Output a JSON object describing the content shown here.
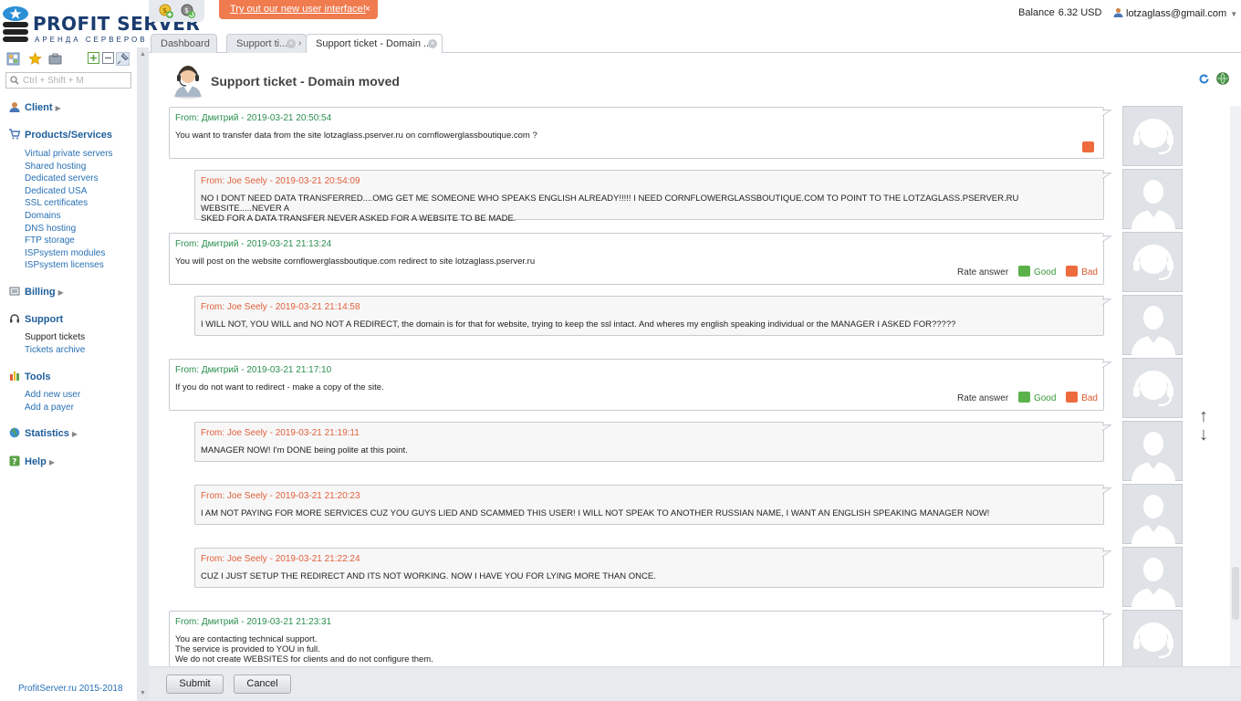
{
  "brand": {
    "name_part1": "PROFIT",
    "name_part2": "SERVER",
    "tagline": "АРЕНДА СЕРВЕРОВ"
  },
  "banner": {
    "link_text": "Try out our new user interface!",
    "close_text": "×"
  },
  "header": {
    "balance_label": "Balance",
    "balance_value": "6.32 USD",
    "user_email": "lotzaglass@gmail.com"
  },
  "tabs": [
    {
      "label": "Dashboard"
    },
    {
      "label": "Support ti..."
    },
    {
      "label": "Support ticket - Domain ..."
    }
  ],
  "sidebar": {
    "search_placeholder": "Ctrl + Shift + M",
    "sections": {
      "client": "Client",
      "products": "Products/Services",
      "billing": "Billing",
      "support": "Support",
      "tools": "Tools",
      "statistics": "Statistics",
      "help": "Help"
    },
    "products_items": [
      "Virtual private servers",
      "Shared hosting",
      "Dedicated servers",
      "Dedicated USA",
      "SSL certificates",
      "Domains",
      "DNS hosting",
      "FTP storage",
      "ISPsystem modules",
      "ISPsystem licenses"
    ],
    "support_items": [
      "Support tickets",
      "Tickets archive"
    ],
    "tools_items": [
      "Add new user",
      "Add a payer"
    ],
    "footer": "ProfitServer.ru 2015-2018"
  },
  "page": {
    "title": "Support ticket - Domain moved"
  },
  "rating": {
    "label": "Rate answer",
    "good": "Good",
    "bad": "Bad"
  },
  "messages": [
    {
      "from": "From: Дмитрий - 2019-03-21 20:50:54",
      "lines": [
        "You want to transfer data from the site lotzaglass.pserver.ru on cornflowerglassboutique.com ?"
      ]
    },
    {
      "from": "From: Joe Seely - 2019-03-21 20:54:09",
      "lines": [
        "NO I DONT NEED DATA TRANSFERRED....OMG GET ME SOMEONE WHO SPEAKS ENGLISH ALREADY!!!!! I NEED CORNFLOWERGLASSBOUTIQUE.COM TO POINT TO THE LOTZAGLASS.PSERVER.RU WEBSITE.....NEVER A",
        "SKED FOR A DATA TRANSFER NEVER ASKED FOR A WEBSITE TO BE MADE."
      ]
    },
    {
      "from": "From: Дмитрий - 2019-03-21 21:13:24",
      "lines": [
        "You will post on the website cornflowerglassboutique.com redirect to site lotzaglass.pserver.ru"
      ]
    },
    {
      "from": "From: Joe Seely - 2019-03-21 21:14:58",
      "lines": [
        "I WILL NOT, YOU WILL and NO NOT A REDIRECT, the domain is for that for website, trying to keep the ssl intact. And wheres my english speaking individual or the MANAGER I ASKED FOR?????"
      ]
    },
    {
      "from": "From: Дмитрий - 2019-03-21 21:17:10",
      "lines": [
        "If you do not want to redirect - make a copy of the site."
      ]
    },
    {
      "from": "From: Joe Seely - 2019-03-21 21:19:11",
      "lines": [
        "MANAGER NOW! I'm DONE being polite at this point."
      ]
    },
    {
      "from": "From: Joe Seely - 2019-03-21 21:20:23",
      "lines": [
        "I AM NOT PAYING FOR MORE SERVICES CUZ YOU GUYS LIED AND SCAMMED THIS USER! I WILL NOT SPEAK TO ANOTHER RUSSIAN NAME, I WANT AN ENGLISH SPEAKING MANAGER NOW!"
      ]
    },
    {
      "from": "From: Joe Seely - 2019-03-21 21:22:24",
      "lines": [
        "CUZ I JUST SETUP THE REDIRECT AND ITS NOT WORKING. NOW I HAVE YOU FOR LYING MORE THAN ONCE."
      ]
    },
    {
      "from": "From: Дмитрий - 2019-03-21 21:23:31",
      "lines": [
        "You are contacting technical support.",
        "The service is provided to YOU in full.",
        "We do not create WEBSITES for clients and do not configure them."
      ]
    }
  ],
  "buttons": {
    "submit": "Submit",
    "cancel": "Cancel"
  },
  "colors": {
    "staff_from": "#2a8f4f",
    "client_from": "#e0603c",
    "link": "#2870b4",
    "banner": "#f07b4f"
  }
}
